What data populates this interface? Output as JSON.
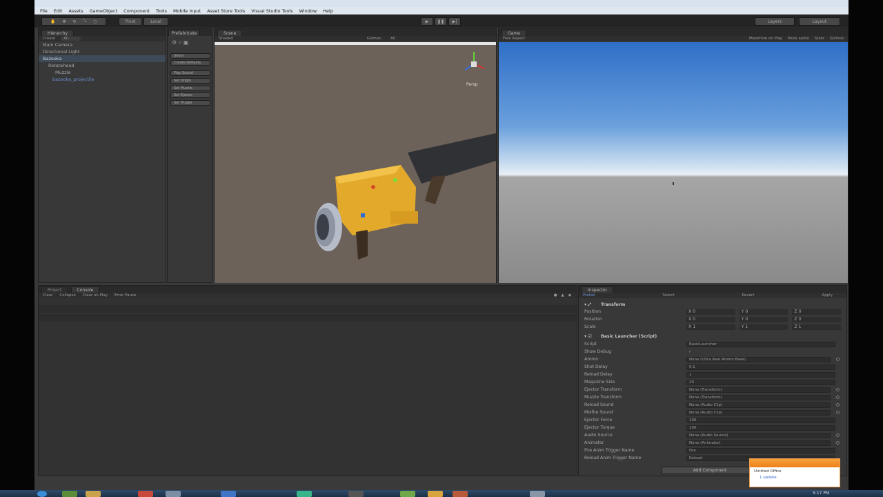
{
  "menu": [
    "File",
    "Edit",
    "Assets",
    "GameObject",
    "Component",
    "Tools",
    "Mobile Input",
    "Asset Store Tools",
    "Visual Studio Tools",
    "Window",
    "Help"
  ],
  "toolbar": {
    "pivot_label": "Pivot",
    "local_label": "Local",
    "layers_label": "Layers",
    "layout_label": "Layout"
  },
  "hierarchy": {
    "tab": "Hierarchy",
    "create": "Create",
    "search_placeholder": "All",
    "items": [
      "Main Camera",
      "Directional Light",
      "Bazooka",
      "Rotatehead",
      "Muzzle",
      "bazooka_projectile"
    ]
  },
  "prefabs": {
    "tab": "Prefabricate",
    "buttons": [
      "Shoot",
      "Create Defaults",
      "Play Sound",
      "Set Origin",
      "Set Muzzle",
      "Set Ejector",
      "Set Trigger"
    ]
  },
  "scene": {
    "tab": "Scene",
    "shading": "Shaded",
    "gizmos": "Gizmos",
    "search": "All",
    "persp": "Persp"
  },
  "game": {
    "tab": "Game",
    "aspect": "Free Aspect",
    "options": [
      "Maximize on Play",
      "Mute audio",
      "Stats",
      "Gizmos"
    ]
  },
  "console": {
    "tabs": [
      "Project",
      "Console"
    ],
    "buttons": [
      "Clear",
      "Collapse",
      "Clear on Play",
      "Error Pause"
    ]
  },
  "inspector": {
    "tab": "Inspector",
    "prefab_bar": [
      "Prefab",
      "Select",
      "Revert",
      "Apply"
    ],
    "transform": {
      "title": "Transform",
      "rows": [
        {
          "label": "Position",
          "x": "0",
          "y": "0",
          "z": "0"
        },
        {
          "label": "Rotation",
          "x": "0",
          "y": "0",
          "z": "0"
        },
        {
          "label": "Scale",
          "x": "1",
          "y": "1",
          "z": "1"
        }
      ]
    },
    "component_title": "Basic Launcher (Script)",
    "fields": [
      {
        "label": "Script",
        "value": "BasicLauncher"
      },
      {
        "label": "Show Debug",
        "value": "✓"
      },
      {
        "label": "Ammo",
        "value": "None (Ultra Real Ammo Base)"
      },
      {
        "label": "Shot Delay",
        "value": "0.1"
      },
      {
        "label": "Reload Delay",
        "value": "1"
      },
      {
        "label": "Magazine Size",
        "value": "20"
      },
      {
        "label": "Ejector Transform",
        "value": "None (Transform)"
      },
      {
        "label": "Muzzle Transform",
        "value": "None (Transform)"
      },
      {
        "label": "Reload Sound",
        "value": "None (Audio Clip)"
      },
      {
        "label": "Misfire Sound",
        "value": "None (Audio Clip)"
      },
      {
        "label": "Ejector Force",
        "value": "100"
      },
      {
        "label": "Ejector Torque",
        "value": "100"
      },
      {
        "label": "Audio Source",
        "value": "None (Audio Source)"
      },
      {
        "label": "Animator",
        "value": "None (Animator)"
      },
      {
        "label": "Fire Anim Trigger Name",
        "value": "Fire"
      },
      {
        "label": "Reload Anim Trigger Name",
        "value": "Reload"
      }
    ],
    "add_component": "Add Component"
  },
  "notification": {
    "line1": "Untitled Office",
    "line2": "1 update"
  },
  "clock": "5:17 PM",
  "colors": {
    "sky_top": "#2f6fc7",
    "horizon": "#e8f0f6",
    "ground": "#8a8a8a",
    "scene_bg": "#6c6259",
    "launcher_yellow": "#e3a92a"
  }
}
